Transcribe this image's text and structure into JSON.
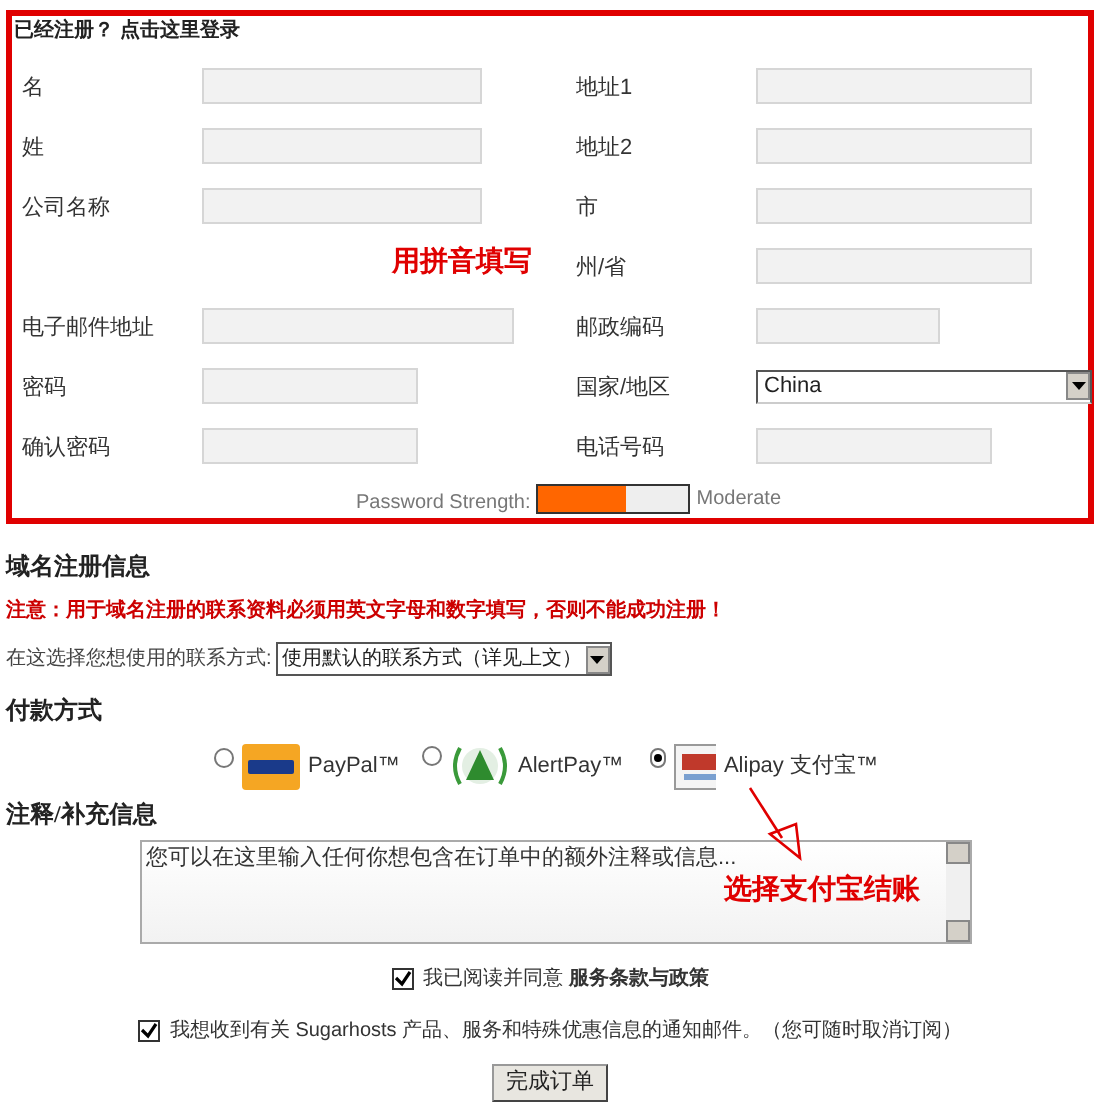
{
  "login_link": "已经注册？ 点击这里登录",
  "rows": [
    {
      "left": {
        "label": "名",
        "kind": "text"
      },
      "right": {
        "label": "地址1",
        "kind": "text"
      }
    },
    {
      "left": {
        "label": "姓",
        "kind": "text"
      },
      "right": {
        "label": "地址2",
        "kind": "text"
      }
    },
    {
      "left": {
        "label": "公司名称",
        "kind": "text"
      },
      "right": {
        "label": "市",
        "kind": "text"
      }
    },
    {
      "right": {
        "label": "州/省",
        "kind": "text"
      }
    },
    {
      "left": {
        "label": "电子邮件地址",
        "kind": "text"
      },
      "right": {
        "label": "邮政编码",
        "kind": "text"
      }
    },
    {
      "left": {
        "label": "密码",
        "kind": "text"
      },
      "right": {
        "label": "国家/地区",
        "kind": "select",
        "value": "China"
      }
    },
    {
      "left": {
        "label": "确认密码",
        "kind": "text"
      },
      "right": {
        "label": "电话号码",
        "kind": "text"
      }
    }
  ],
  "pinyin_note": "用拼音填写",
  "password_strength": {
    "label": "Password Strength:",
    "level": 0.58,
    "reading": "Moderate"
  },
  "domain_section": {
    "title": "域名注册信息",
    "warning": "注意：用于域名注册的联系资料必须用英文字母和数字填写，否则不能成功注册！",
    "contact_label": "在这选择您想使用的联系方式:",
    "contact_value": "使用默认的联系方式（详见上文）"
  },
  "payment": {
    "title": "付款方式",
    "options": [
      {
        "kind": "paypal",
        "label": "PayPal™",
        "selected": false
      },
      {
        "kind": "alertpay",
        "label": "AlertPay™",
        "selected": false
      },
      {
        "kind": "alipay",
        "label": "Alipay 支付宝™",
        "selected": true
      }
    ]
  },
  "notes": {
    "title": "注释/补充信息",
    "placeholder": "您可以在这里输入任何你想包含在订单中的额外注释或信息...",
    "annotation": "选择支付宝结账"
  },
  "agreements": [
    {
      "text": "我已阅读并同意 **服务条款与政策**",
      "checked": true
    },
    {
      "text": "我想收到有关 Sugarhosts 产品、服务和特殊优惠信息的通知邮件。（您可随时取消订阅）",
      "checked": true
    }
  ],
  "submit": "完成订单"
}
